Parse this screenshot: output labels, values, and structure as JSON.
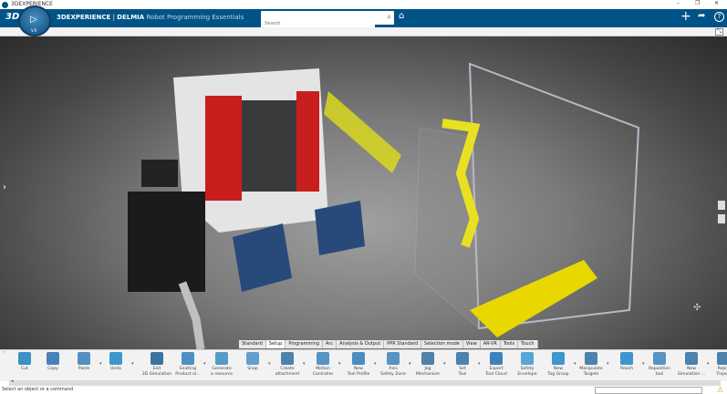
{
  "window": {
    "title": "3DEXPERIENCE",
    "controls": [
      "–",
      "❐",
      "✕"
    ]
  },
  "appbar": {
    "brand": "3DEXPERIENCE",
    "separator": "|",
    "product": "DELMIA",
    "app": "Robot Programming Essentials",
    "search_placeholder": "Search",
    "compass_label": "V.R"
  },
  "colors": {
    "appbar": "#005386",
    "accent": "#0f79c0",
    "safety_yellow": "#e0e020"
  },
  "tabs": [
    {
      "label": "Standard"
    },
    {
      "label": "Setup",
      "selected": true
    },
    {
      "label": "Programming"
    },
    {
      "label": "Arc"
    },
    {
      "label": "Analysis & Output"
    },
    {
      "label": "PPR Standard"
    },
    {
      "label": "Selection mode"
    },
    {
      "label": "View"
    },
    {
      "label": "AR-VR"
    },
    {
      "label": "Tools"
    },
    {
      "label": "Touch"
    }
  ],
  "toolbar": [
    {
      "l1": "Cut",
      "l2": "",
      "icon": "scissors-icon"
    },
    {
      "l1": "Copy",
      "l2": "",
      "icon": "copy-icon"
    },
    {
      "l1": "Paste",
      "l2": "",
      "icon": "paste-icon",
      "drop": true
    },
    {
      "l1": "Undo",
      "l2": "",
      "icon": "undo-icon",
      "drop": true
    },
    {
      "l1": "Exit",
      "l2": "3D Simulation",
      "icon": "exit-simulation-icon"
    },
    {
      "l1": "Existing",
      "l2": "Product or...",
      "icon": "existing-product-icon",
      "drop": true
    },
    {
      "l1": "Generate",
      "l2": "a resource",
      "icon": "generate-resource-icon"
    },
    {
      "l1": "Snap",
      "l2": "",
      "icon": "snap-icon",
      "drop": true
    },
    {
      "l1": "Create",
      "l2": "attachment",
      "icon": "attachment-icon",
      "drop": true
    },
    {
      "l1": "Motion",
      "l2": "Controller",
      "icon": "motion-controller-icon",
      "drop": true
    },
    {
      "l1": "New",
      "l2": "Tool Profile",
      "icon": "tool-profile-icon",
      "drop": true
    },
    {
      "l1": "Axis",
      "l2": "Safety Zone",
      "icon": "safety-zone-icon",
      "drop": true
    },
    {
      "l1": "Jog",
      "l2": "Mechanism",
      "icon": "jog-icon",
      "drop": true
    },
    {
      "l1": "Set",
      "l2": "Tool",
      "icon": "set-tool-icon",
      "drop": true
    },
    {
      "l1": "Export",
      "l2": "Tool Cloud",
      "icon": "export-cloud-icon"
    },
    {
      "l1": "Safety",
      "l2": "Envelope",
      "icon": "safety-envelope-icon"
    },
    {
      "l1": "New",
      "l2": "Tag Group",
      "icon": "tag-group-icon",
      "drop": true
    },
    {
      "l1": "Manipulate",
      "l2": "Targets",
      "icon": "manipulate-targets-icon",
      "drop": true
    },
    {
      "l1": "Reach",
      "l2": "",
      "icon": "reach-icon",
      "drop": true
    },
    {
      "l1": "Reposition",
      "l2": "tool",
      "icon": "reposition-icon"
    },
    {
      "l1": "New",
      "l2": "Simulation ...",
      "icon": "simulation-icon",
      "drop": true
    },
    {
      "l1": "Repla",
      "l2": "Traject",
      "icon": "replay-icon"
    }
  ],
  "status": {
    "message": "Select an object or a command",
    "command_input": ""
  }
}
